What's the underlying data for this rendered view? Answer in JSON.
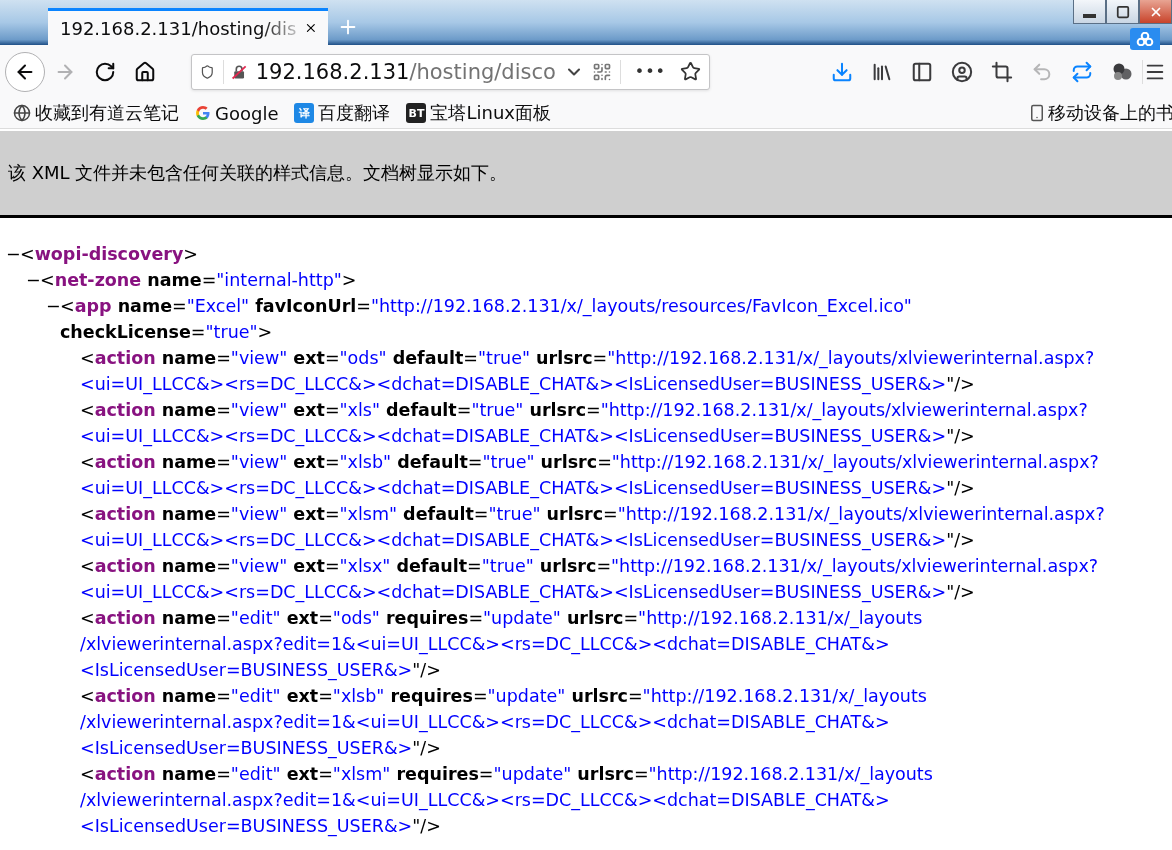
{
  "tabs": [
    {
      "title": "192.168.2.131/hosting/dis",
      "selected": true
    }
  ],
  "window_controls": [
    {
      "kind": "minimize"
    },
    {
      "kind": "maximize"
    },
    {
      "kind": "close"
    }
  ],
  "nav": [
    {
      "kind": "back",
      "disabled": false
    },
    {
      "kind": "forward",
      "disabled": true
    },
    {
      "kind": "reload",
      "disabled": false
    },
    {
      "kind": "home",
      "disabled": false
    }
  ],
  "address": {
    "host": "192.168.2.131",
    "path": "/hosting/disco",
    "more": "•••"
  },
  "tools": [
    {
      "kind": "download",
      "highlighted": true,
      "disabled": false
    },
    {
      "kind": "library",
      "highlighted": false,
      "disabled": false
    },
    {
      "kind": "sidebar",
      "highlighted": false,
      "disabled": false
    },
    {
      "kind": "account",
      "highlighted": false,
      "disabled": false
    },
    {
      "kind": "crop",
      "highlighted": false,
      "disabled": false
    },
    {
      "kind": "undo",
      "highlighted": false,
      "disabled": true
    },
    {
      "kind": "sync",
      "highlighted": true,
      "disabled": false
    },
    {
      "kind": "balls",
      "highlighted": false,
      "disabled": false
    }
  ],
  "bookmarks": [
    {
      "kind": "globe",
      "label": "收藏到有道云笔记"
    },
    {
      "kind": "google",
      "label": "Google"
    },
    {
      "kind": "badge",
      "badge": "译",
      "color": "#1e88e5",
      "label": "百度翻译"
    },
    {
      "kind": "badge",
      "badge": "BT",
      "color": "#222222",
      "label": "宝塔Linux面板"
    }
  ],
  "mobile_bookmarks": {
    "label": "移动设备上的书"
  },
  "notice": "该 XML 文件并未包含任何关联的样式信息。文档树显示如下。",
  "xml": {
    "toggle": "−",
    "lines": [
      [
        {
          "kind": "punct",
          "text": "<"
        },
        {
          "kind": "tag",
          "text": "wopi-discovery"
        },
        {
          "kind": "punct",
          "text": ">"
        }
      ]
    ],
    "children": [
      {
        "toggle": "−",
        "lines": [
          [
            {
              "kind": "punct",
              "text": "<"
            },
            {
              "kind": "tag",
              "text": "net-zone"
            },
            {
              "kind": "attr",
              "text": " name"
            },
            {
              "kind": "punct",
              "text": "="
            },
            {
              "kind": "value",
              "text": "\"internal-http\""
            },
            {
              "kind": "punct",
              "text": ">"
            }
          ]
        ],
        "children": [
          {
            "toggle": "−",
            "lines": [
              [
                {
                  "kind": "punct",
                  "text": "<"
                },
                {
                  "kind": "tag",
                  "text": "app"
                },
                {
                  "kind": "attr",
                  "text": " name"
                },
                {
                  "kind": "punct",
                  "text": "="
                },
                {
                  "kind": "value",
                  "text": "\"Excel\""
                },
                {
                  "kind": "attr",
                  "text": " favIconUrl"
                },
                {
                  "kind": "punct",
                  "text": "="
                },
                {
                  "kind": "value",
                  "text": "\"http://192.168.2.131/x/_layouts/resources/FavIcon_Excel.ico\""
                }
              ],
              [
                {
                  "kind": "attr",
                  "text": "checkLicense"
                },
                {
                  "kind": "punct",
                  "text": "="
                },
                {
                  "kind": "value",
                  "text": "\"true\""
                },
                {
                  "kind": "punct",
                  "text": ">"
                }
              ]
            ],
            "children": [
              {
                "lines": [
                  [
                    {
                      "kind": "punct",
                      "text": "<"
                    },
                    {
                      "kind": "tag",
                      "text": "action"
                    },
                    {
                      "kind": "attr",
                      "text": " name"
                    },
                    {
                      "kind": "punct",
                      "text": "="
                    },
                    {
                      "kind": "value",
                      "text": "\"view\""
                    },
                    {
                      "kind": "attr",
                      "text": " ext"
                    },
                    {
                      "kind": "punct",
                      "text": "="
                    },
                    {
                      "kind": "value",
                      "text": "\"ods\""
                    },
                    {
                      "kind": "attr",
                      "text": " default"
                    },
                    {
                      "kind": "punct",
                      "text": "="
                    },
                    {
                      "kind": "value",
                      "text": "\"true\""
                    },
                    {
                      "kind": "attr",
                      "text": " urlsrc"
                    },
                    {
                      "kind": "punct",
                      "text": "="
                    },
                    {
                      "kind": "value",
                      "text": "\"http://192.168.2.131/x/_layouts/xlviewerinternal.aspx?"
                    }
                  ],
                  [
                    {
                      "kind": "value",
                      "text": "<ui=UI_LLCC&><rs=DC_LLCC&><dchat=DISABLE_CHAT&><IsLicensedUser=BUSINESS_USER&>"
                    },
                    {
                      "kind": "punct",
                      "text": "\"/>"
                    }
                  ]
                ]
              },
              {
                "lines": [
                  [
                    {
                      "kind": "punct",
                      "text": "<"
                    },
                    {
                      "kind": "tag",
                      "text": "action"
                    },
                    {
                      "kind": "attr",
                      "text": " name"
                    },
                    {
                      "kind": "punct",
                      "text": "="
                    },
                    {
                      "kind": "value",
                      "text": "\"view\""
                    },
                    {
                      "kind": "attr",
                      "text": " ext"
                    },
                    {
                      "kind": "punct",
                      "text": "="
                    },
                    {
                      "kind": "value",
                      "text": "\"xls\""
                    },
                    {
                      "kind": "attr",
                      "text": " default"
                    },
                    {
                      "kind": "punct",
                      "text": "="
                    },
                    {
                      "kind": "value",
                      "text": "\"true\""
                    },
                    {
                      "kind": "attr",
                      "text": " urlsrc"
                    },
                    {
                      "kind": "punct",
                      "text": "="
                    },
                    {
                      "kind": "value",
                      "text": "\"http://192.168.2.131/x/_layouts/xlviewerinternal.aspx?"
                    }
                  ],
                  [
                    {
                      "kind": "value",
                      "text": "<ui=UI_LLCC&><rs=DC_LLCC&><dchat=DISABLE_CHAT&><IsLicensedUser=BUSINESS_USER&>"
                    },
                    {
                      "kind": "punct",
                      "text": "\"/>"
                    }
                  ]
                ]
              },
              {
                "lines": [
                  [
                    {
                      "kind": "punct",
                      "text": "<"
                    },
                    {
                      "kind": "tag",
                      "text": "action"
                    },
                    {
                      "kind": "attr",
                      "text": " name"
                    },
                    {
                      "kind": "punct",
                      "text": "="
                    },
                    {
                      "kind": "value",
                      "text": "\"view\""
                    },
                    {
                      "kind": "attr",
                      "text": " ext"
                    },
                    {
                      "kind": "punct",
                      "text": "="
                    },
                    {
                      "kind": "value",
                      "text": "\"xlsb\""
                    },
                    {
                      "kind": "attr",
                      "text": " default"
                    },
                    {
                      "kind": "punct",
                      "text": "="
                    },
                    {
                      "kind": "value",
                      "text": "\"true\""
                    },
                    {
                      "kind": "attr",
                      "text": " urlsrc"
                    },
                    {
                      "kind": "punct",
                      "text": "="
                    },
                    {
                      "kind": "value",
                      "text": "\"http://192.168.2.131/x/_layouts/xlviewerinternal.aspx?"
                    }
                  ],
                  [
                    {
                      "kind": "value",
                      "text": "<ui=UI_LLCC&><rs=DC_LLCC&><dchat=DISABLE_CHAT&><IsLicensedUser=BUSINESS_USER&>"
                    },
                    {
                      "kind": "punct",
                      "text": "\"/>"
                    }
                  ]
                ]
              },
              {
                "lines": [
                  [
                    {
                      "kind": "punct",
                      "text": "<"
                    },
                    {
                      "kind": "tag",
                      "text": "action"
                    },
                    {
                      "kind": "attr",
                      "text": " name"
                    },
                    {
                      "kind": "punct",
                      "text": "="
                    },
                    {
                      "kind": "value",
                      "text": "\"view\""
                    },
                    {
                      "kind": "attr",
                      "text": " ext"
                    },
                    {
                      "kind": "punct",
                      "text": "="
                    },
                    {
                      "kind": "value",
                      "text": "\"xlsm\""
                    },
                    {
                      "kind": "attr",
                      "text": " default"
                    },
                    {
                      "kind": "punct",
                      "text": "="
                    },
                    {
                      "kind": "value",
                      "text": "\"true\""
                    },
                    {
                      "kind": "attr",
                      "text": " urlsrc"
                    },
                    {
                      "kind": "punct",
                      "text": "="
                    },
                    {
                      "kind": "value",
                      "text": "\"http://192.168.2.131/x/_layouts/xlviewerinternal.aspx?"
                    }
                  ],
                  [
                    {
                      "kind": "value",
                      "text": "<ui=UI_LLCC&><rs=DC_LLCC&><dchat=DISABLE_CHAT&><IsLicensedUser=BUSINESS_USER&>"
                    },
                    {
                      "kind": "punct",
                      "text": "\"/>"
                    }
                  ]
                ]
              },
              {
                "lines": [
                  [
                    {
                      "kind": "punct",
                      "text": "<"
                    },
                    {
                      "kind": "tag",
                      "text": "action"
                    },
                    {
                      "kind": "attr",
                      "text": " name"
                    },
                    {
                      "kind": "punct",
                      "text": "="
                    },
                    {
                      "kind": "value",
                      "text": "\"view\""
                    },
                    {
                      "kind": "attr",
                      "text": " ext"
                    },
                    {
                      "kind": "punct",
                      "text": "="
                    },
                    {
                      "kind": "value",
                      "text": "\"xlsx\""
                    },
                    {
                      "kind": "attr",
                      "text": " default"
                    },
                    {
                      "kind": "punct",
                      "text": "="
                    },
                    {
                      "kind": "value",
                      "text": "\"true\""
                    },
                    {
                      "kind": "attr",
                      "text": " urlsrc"
                    },
                    {
                      "kind": "punct",
                      "text": "="
                    },
                    {
                      "kind": "value",
                      "text": "\"http://192.168.2.131/x/_layouts/xlviewerinternal.aspx?"
                    }
                  ],
                  [
                    {
                      "kind": "value",
                      "text": "<ui=UI_LLCC&><rs=DC_LLCC&><dchat=DISABLE_CHAT&><IsLicensedUser=BUSINESS_USER&>"
                    },
                    {
                      "kind": "punct",
                      "text": "\"/>"
                    }
                  ]
                ]
              },
              {
                "lines": [
                  [
                    {
                      "kind": "punct",
                      "text": "<"
                    },
                    {
                      "kind": "tag",
                      "text": "action"
                    },
                    {
                      "kind": "attr",
                      "text": " name"
                    },
                    {
                      "kind": "punct",
                      "text": "="
                    },
                    {
                      "kind": "value",
                      "text": "\"edit\""
                    },
                    {
                      "kind": "attr",
                      "text": " ext"
                    },
                    {
                      "kind": "punct",
                      "text": "="
                    },
                    {
                      "kind": "value",
                      "text": "\"ods\""
                    },
                    {
                      "kind": "attr",
                      "text": " requires"
                    },
                    {
                      "kind": "punct",
                      "text": "="
                    },
                    {
                      "kind": "value",
                      "text": "\"update\""
                    },
                    {
                      "kind": "attr",
                      "text": " urlsrc"
                    },
                    {
                      "kind": "punct",
                      "text": "="
                    },
                    {
                      "kind": "value",
                      "text": "\"http://192.168.2.131/x/_layouts"
                    }
                  ],
                  [
                    {
                      "kind": "value",
                      "text": "/xlviewerinternal.aspx?edit=1&<ui=UI_LLCC&><rs=DC_LLCC&><dchat=DISABLE_CHAT&>"
                    }
                  ],
                  [
                    {
                      "kind": "value",
                      "text": "<IsLicensedUser=BUSINESS_USER&>"
                    },
                    {
                      "kind": "punct",
                      "text": "\"/>"
                    }
                  ]
                ]
              },
              {
                "lines": [
                  [
                    {
                      "kind": "punct",
                      "text": "<"
                    },
                    {
                      "kind": "tag",
                      "text": "action"
                    },
                    {
                      "kind": "attr",
                      "text": " name"
                    },
                    {
                      "kind": "punct",
                      "text": "="
                    },
                    {
                      "kind": "value",
                      "text": "\"edit\""
                    },
                    {
                      "kind": "attr",
                      "text": " ext"
                    },
                    {
                      "kind": "punct",
                      "text": "="
                    },
                    {
                      "kind": "value",
                      "text": "\"xlsb\""
                    },
                    {
                      "kind": "attr",
                      "text": " requires"
                    },
                    {
                      "kind": "punct",
                      "text": "="
                    },
                    {
                      "kind": "value",
                      "text": "\"update\""
                    },
                    {
                      "kind": "attr",
                      "text": " urlsrc"
                    },
                    {
                      "kind": "punct",
                      "text": "="
                    },
                    {
                      "kind": "value",
                      "text": "\"http://192.168.2.131/x/_layouts"
                    }
                  ],
                  [
                    {
                      "kind": "value",
                      "text": "/xlviewerinternal.aspx?edit=1&<ui=UI_LLCC&><rs=DC_LLCC&><dchat=DISABLE_CHAT&>"
                    }
                  ],
                  [
                    {
                      "kind": "value",
                      "text": "<IsLicensedUser=BUSINESS_USER&>"
                    },
                    {
                      "kind": "punct",
                      "text": "\"/>"
                    }
                  ]
                ]
              },
              {
                "lines": [
                  [
                    {
                      "kind": "punct",
                      "text": "<"
                    },
                    {
                      "kind": "tag",
                      "text": "action"
                    },
                    {
                      "kind": "attr",
                      "text": " name"
                    },
                    {
                      "kind": "punct",
                      "text": "="
                    },
                    {
                      "kind": "value",
                      "text": "\"edit\""
                    },
                    {
                      "kind": "attr",
                      "text": " ext"
                    },
                    {
                      "kind": "punct",
                      "text": "="
                    },
                    {
                      "kind": "value",
                      "text": "\"xlsm\""
                    },
                    {
                      "kind": "attr",
                      "text": " requires"
                    },
                    {
                      "kind": "punct",
                      "text": "="
                    },
                    {
                      "kind": "value",
                      "text": "\"update\""
                    },
                    {
                      "kind": "attr",
                      "text": " urlsrc"
                    },
                    {
                      "kind": "punct",
                      "text": "="
                    },
                    {
                      "kind": "value",
                      "text": "\"http://192.168.2.131/x/_layouts"
                    }
                  ],
                  [
                    {
                      "kind": "value",
                      "text": "/xlviewerinternal.aspx?edit=1&<ui=UI_LLCC&><rs=DC_LLCC&><dchat=DISABLE_CHAT&>"
                    }
                  ],
                  [
                    {
                      "kind": "value",
                      "text": "<IsLicensedUser=BUSINESS_USER&>"
                    },
                    {
                      "kind": "punct",
                      "text": "\"/>"
                    }
                  ]
                ]
              }
            ]
          }
        ]
      }
    ]
  }
}
